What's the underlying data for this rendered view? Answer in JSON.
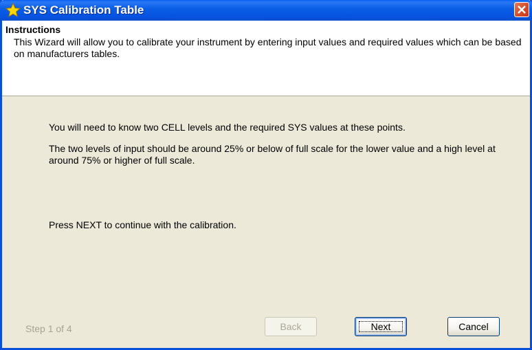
{
  "window": {
    "title": "SYS Calibration Table",
    "title_icon": "star-icon",
    "close_icon": "close-icon"
  },
  "header": {
    "title": "Instructions",
    "description": "This Wizard will allow you to calibrate your instrument by entering input values and required values which can be based on manufacturers tables."
  },
  "body": {
    "para1": "You will need to know two CELL levels and the required SYS values at these points.",
    "para2": "The two levels of input should be around 25%  or below of full scale for the lower value and a high level at around 75% or higher of full scale.",
    "para3": "Press NEXT to continue with the calibration."
  },
  "footer": {
    "step_label": "Step 1 of 4",
    "back_label": "Back",
    "next_label": "Next",
    "cancel_label": "Cancel"
  },
  "colors": {
    "titlebar": "#0553e0",
    "dialog_bg": "#ece9d8",
    "disabled_text": "#aca899"
  }
}
